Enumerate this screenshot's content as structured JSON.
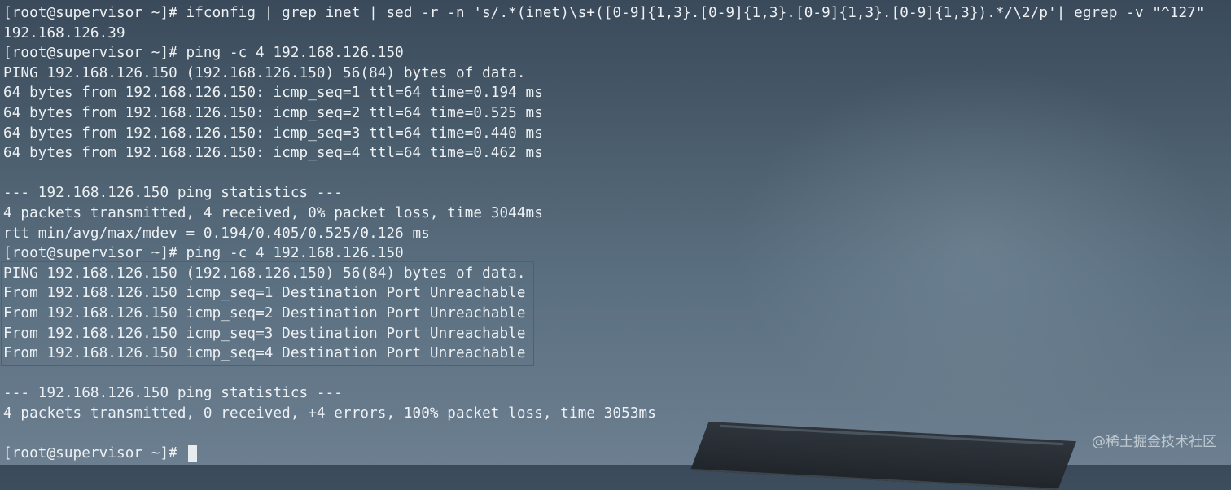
{
  "terminal": {
    "lines": [
      "[root@supervisor ~]# ifconfig | grep inet | sed -r -n 's/.*(inet)\\s+([0-9]{1,3}.[0-9]{1,3}.[0-9]{1,3}.[0-9]{1,3}).*/\\2/p'| egrep -v \"^127\"",
      "192.168.126.39",
      "[root@supervisor ~]# ping -c 4 192.168.126.150",
      "PING 192.168.126.150 (192.168.126.150) 56(84) bytes of data.",
      "64 bytes from 192.168.126.150: icmp_seq=1 ttl=64 time=0.194 ms",
      "64 bytes from 192.168.126.150: icmp_seq=2 ttl=64 time=0.525 ms",
      "64 bytes from 192.168.126.150: icmp_seq=3 ttl=64 time=0.440 ms",
      "64 bytes from 192.168.126.150: icmp_seq=4 ttl=64 time=0.462 ms",
      "",
      "--- 192.168.126.150 ping statistics ---",
      "4 packets transmitted, 4 received, 0% packet loss, time 3044ms",
      "rtt min/avg/max/mdev = 0.194/0.405/0.525/0.126 ms",
      "[root@supervisor ~]# ping -c 4 192.168.126.150",
      "PING 192.168.126.150 (192.168.126.150) 56(84) bytes of data.",
      "From 192.168.126.150 icmp_seq=1 Destination Port Unreachable",
      "From 192.168.126.150 icmp_seq=2 Destination Port Unreachable",
      "From 192.168.126.150 icmp_seq=3 Destination Port Unreachable",
      "From 192.168.126.150 icmp_seq=4 Destination Port Unreachable",
      "",
      "--- 192.168.126.150 ping statistics ---",
      "4 packets transmitted, 0 received, +4 errors, 100% packet loss, time 3053ms",
      ""
    ],
    "final_prompt": "[root@supervisor ~]# "
  },
  "watermark": "@稀土掘金技术社区",
  "colors": {
    "text": "#eef1f4",
    "highlight_border": "#c9302c",
    "background_top": "#3a4a5a",
    "background_bottom": "#6c7f90"
  }
}
